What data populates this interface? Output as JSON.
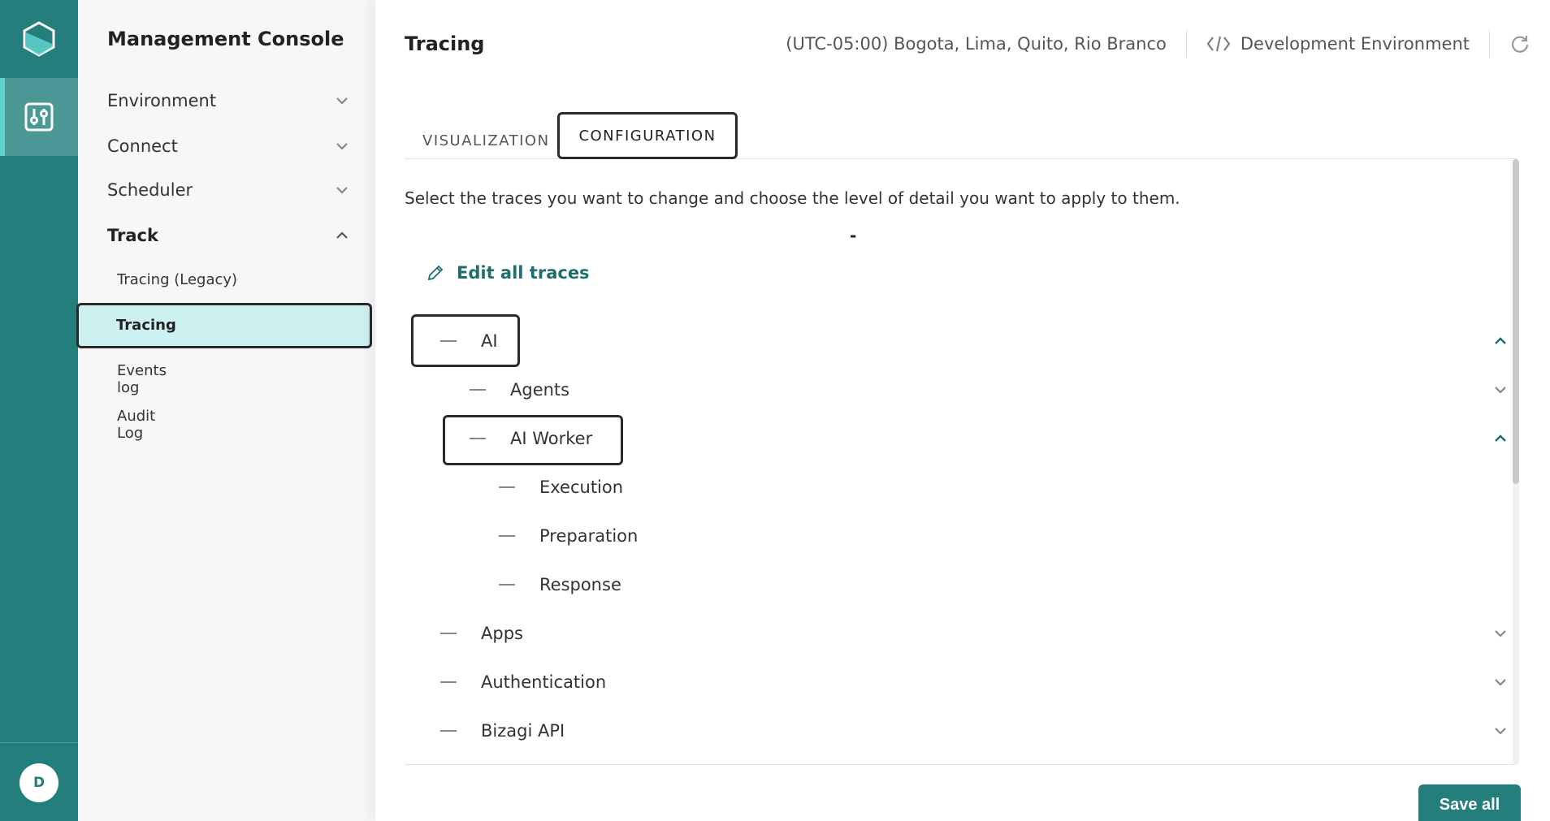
{
  "rail": {
    "avatar_initial": "D"
  },
  "sidebar": {
    "title": "Management Console",
    "menu": [
      {
        "label": "Environment",
        "expanded": false
      },
      {
        "label": "Connect",
        "expanded": false
      },
      {
        "label": "Scheduler",
        "expanded": false
      },
      {
        "label": "Track",
        "expanded": true
      }
    ],
    "track_items": [
      {
        "label": "Tracing (Legacy)"
      },
      {
        "label": "Tracing",
        "active": true
      },
      {
        "label": "Events log"
      },
      {
        "label": "Audit Log"
      }
    ]
  },
  "header": {
    "title": "Tracing",
    "timezone": "(UTC-05:00) Bogota, Lima, Quito, Rio Branco",
    "environment": "Development Environment"
  },
  "tabs": [
    {
      "label": "VISUALIZATION",
      "active": false
    },
    {
      "label": "CONFIGURATION",
      "active": true
    }
  ],
  "content": {
    "description": "Select the traces you want to change and choose the level of detail you want to apply to them.",
    "dash": "-",
    "edit_all_label": "Edit all traces"
  },
  "tree": [
    {
      "label": "AI",
      "level": 0,
      "expanded": true
    },
    {
      "label": "Agents",
      "level": 1,
      "expanded": false
    },
    {
      "label": "AI Worker",
      "level": 1,
      "expanded": true
    },
    {
      "label": "Execution",
      "level": 2
    },
    {
      "label": "Preparation",
      "level": 2
    },
    {
      "label": "Response",
      "level": 2
    },
    {
      "label": "Apps",
      "level": 0,
      "expanded": false
    },
    {
      "label": "Authentication",
      "level": 0,
      "expanded": false
    },
    {
      "label": "Bizagi API",
      "level": 0,
      "expanded": false
    }
  ],
  "footer": {
    "save_label": "Save all"
  },
  "colors": {
    "primary": "#237e7c",
    "active_bg": "#cdf1f1",
    "accent": "#5fd3cc"
  }
}
